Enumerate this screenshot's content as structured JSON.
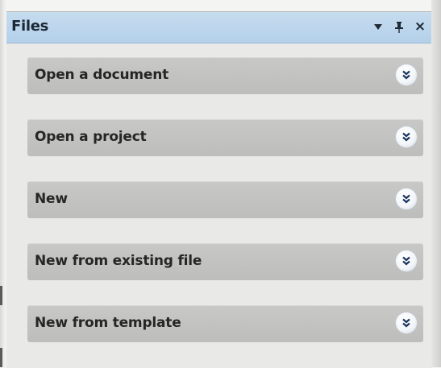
{
  "panel": {
    "title": "Files",
    "menu_icon": "dropdown-triangle-icon",
    "pin_icon": "pin-icon",
    "close_label": "×"
  },
  "items": [
    {
      "label": "Open a document",
      "icon": "double-chevron-down-icon"
    },
    {
      "label": "Open a project",
      "icon": "double-chevron-down-icon"
    },
    {
      "label": "New",
      "icon": "double-chevron-down-icon"
    },
    {
      "label": "New from existing file",
      "icon": "double-chevron-down-icon"
    },
    {
      "label": "New from template",
      "icon": "double-chevron-down-icon"
    }
  ],
  "colors": {
    "titlebar": "#b4d0ea",
    "item_background": "#c0c0be",
    "pane_background": "#e9e9e7"
  }
}
